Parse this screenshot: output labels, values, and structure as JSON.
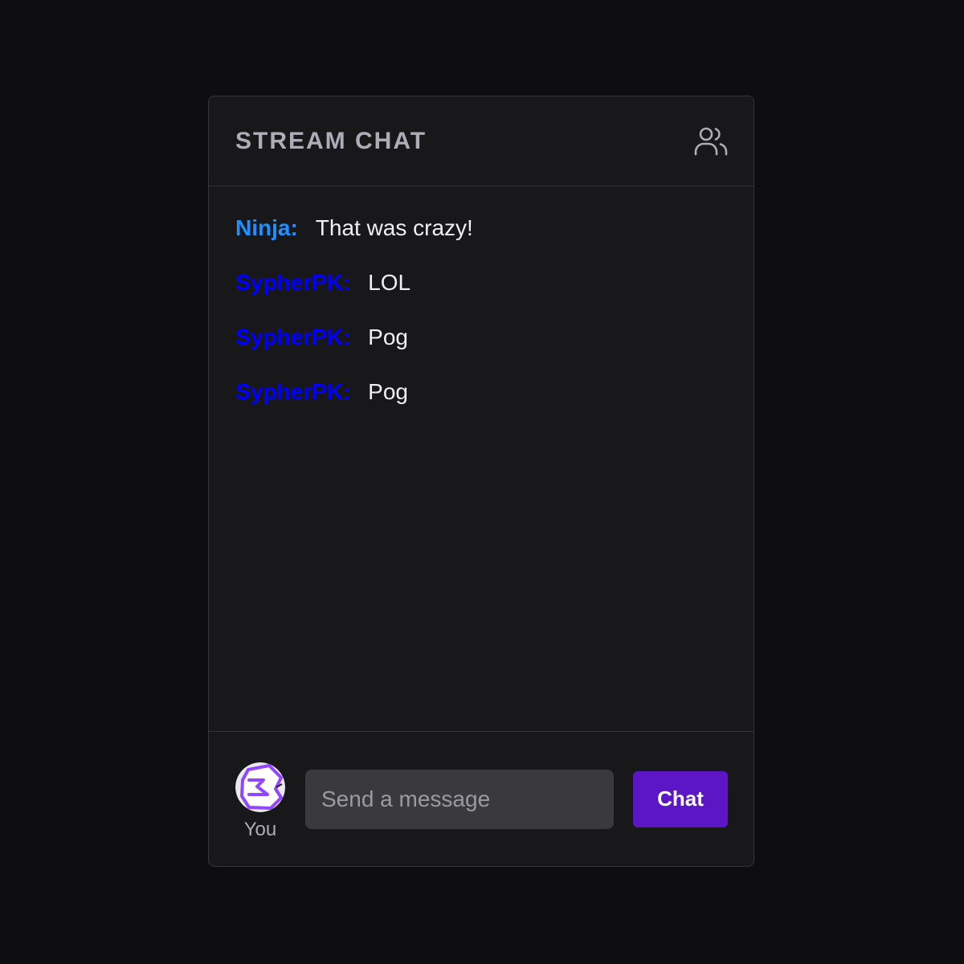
{
  "header": {
    "title": "STREAM CHAT",
    "users_icon": "users-icon"
  },
  "messages": [
    {
      "user": "Ninja:",
      "text": "That was crazy!",
      "color": "#1e90ff"
    },
    {
      "user": "SypherPK:",
      "text": "LOL",
      "color": "#0000ff"
    },
    {
      "user": "SypherPK:",
      "text": "Pog",
      "color": "#0000ff"
    },
    {
      "user": "SypherPK:",
      "text": "Pog",
      "color": "#0000ff"
    }
  ],
  "composer": {
    "avatar_icon": "user-avatar",
    "you_label": "You",
    "placeholder": "Send a message",
    "value": "",
    "send_label": "Chat"
  },
  "colors": {
    "accent": "#5c16c5",
    "panel_bg": "#18181b",
    "page_bg": "#0e0e10",
    "input_bg": "#3a3a3d"
  }
}
